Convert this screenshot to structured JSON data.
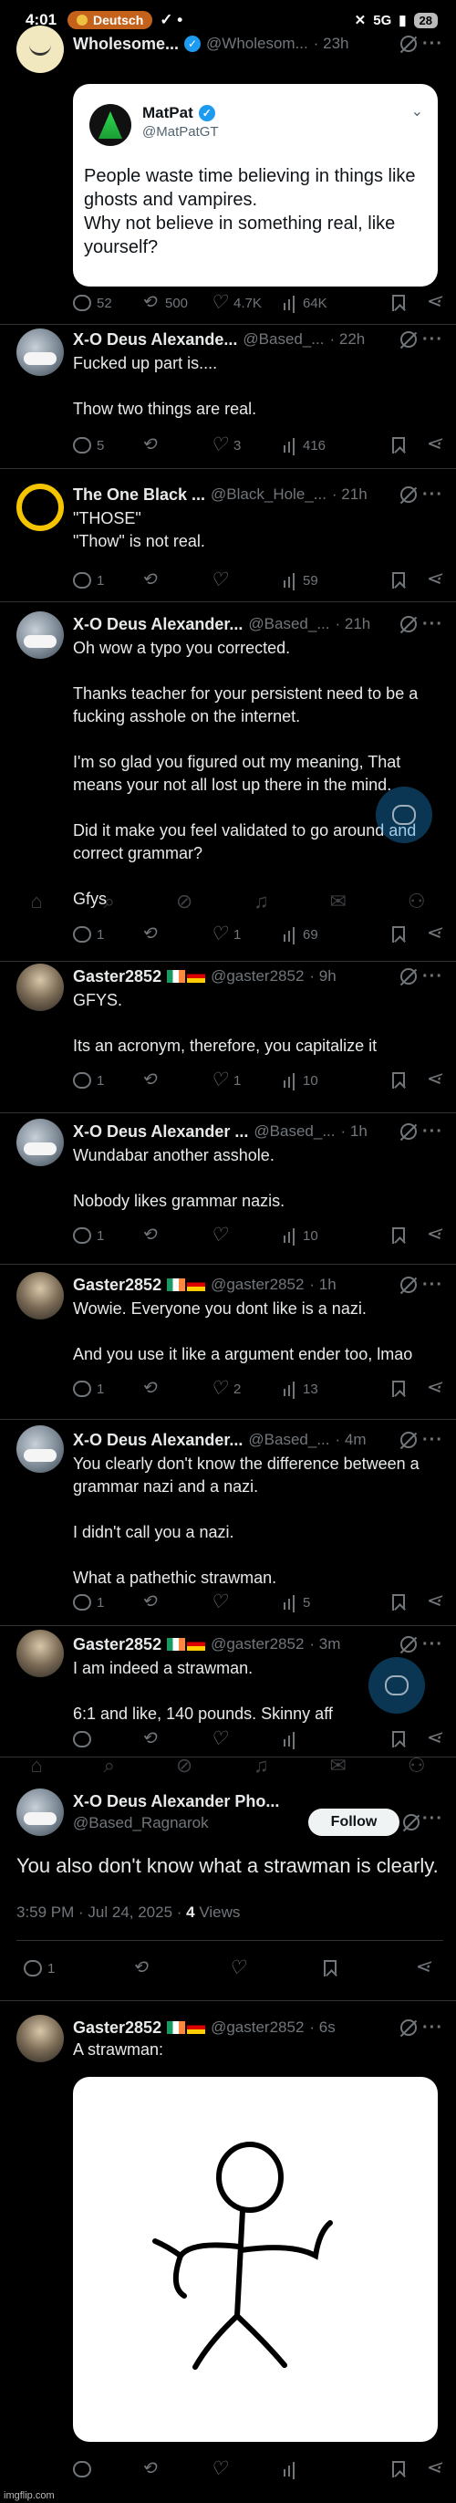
{
  "status": {
    "time": "4:01",
    "app_pill": "Deutsch",
    "network": "5G",
    "battery": "28"
  },
  "posts": [
    {
      "name": "Wholesome...",
      "handle": "@Wholesom...",
      "time": "· 23h",
      "quote": {
        "name": "MatPat",
        "handle": "@MatPatGT",
        "text": "People waste time believing in things like ghosts and vampires.\nWhy not believe in something real, like yourself?"
      },
      "replies": "52",
      "reposts": "500",
      "likes": "4.7K",
      "views": "64K"
    },
    {
      "name": "X-O Deus Alexande...",
      "handle": "@Based_...",
      "time": "· 22h",
      "text": "Fucked up part is....\n\nThow two things are real.",
      "replies": "5",
      "reposts": "",
      "likes": "3",
      "views": "416"
    },
    {
      "name": "The One Black ...",
      "handle": "@Black_Hole_...",
      "time": "· 21h",
      "text": "\"THOSE\"\n\"Thow\" is not real.",
      "replies": "1",
      "reposts": "",
      "likes": "",
      "views": "59"
    },
    {
      "name": "X-O Deus Alexander...",
      "handle": "@Based_...",
      "time": "· 21h",
      "text": "Oh wow a typo you corrected.\n\nThanks teacher for your persistent need to be a fucking asshole on the internet.\n\nI'm so glad you figured out my meaning, That means your not all lost up there in the mind.\n\nDid it make you feel validated to go around and correct grammar?\n\nGfys",
      "replies": "1",
      "reposts": "",
      "likes": "1",
      "views": "69"
    },
    {
      "name": "Gaster2852",
      "handle": "@gaster2852",
      "time": "· 9h",
      "text": "GFYS.\n\nIts an acronym, therefore, you capitalize it",
      "replies": "1",
      "reposts": "",
      "likes": "1",
      "views": "10"
    },
    {
      "name": "X-O Deus Alexander ...",
      "handle": "@Based_...",
      "time": "· 1h",
      "text": "Wundabar another asshole.\n\nNobody likes grammar nazis.",
      "replies": "1",
      "reposts": "",
      "likes": "",
      "views": "10"
    },
    {
      "name": "Gaster2852",
      "handle": "@gaster2852",
      "time": "· 1h",
      "text": "Wowie. Everyone you dont like is a nazi.\n\nAnd you use it like a argument ender too, lmao",
      "replies": "1",
      "reposts": "",
      "likes": "2",
      "views": "13"
    },
    {
      "name": "X-O Deus Alexander...",
      "handle": "@Based_...",
      "time": "· 4m",
      "text": "You clearly don't know the difference between a grammar nazi and a nazi.\n\nI didn't call you a nazi.\n\nWhat a pathethic strawman.",
      "replies": "1",
      "reposts": "",
      "likes": "",
      "views": "5"
    },
    {
      "name": "Gaster2852",
      "handle": "@gaster2852",
      "time": "· 3m",
      "text": "I am indeed a strawman.\n\n6:1 and like, 140 pounds. Skinny aff",
      "replies": "",
      "reposts": "",
      "likes": "",
      "views": ""
    }
  ],
  "focal": {
    "name": "X-O Deus Alexander Pho...",
    "handle": "@Based_Ragnarok",
    "follow": "Follow",
    "text": "You also don't know what a strawman is clearly.",
    "meta_time": "3:59 PM · Jul 24, 2025 · ",
    "meta_views_count": "4",
    "meta_views_label": " Views",
    "replies": "1"
  },
  "last": {
    "name": "Gaster2852",
    "handle": "@gaster2852",
    "time": "· 6s",
    "text": "A strawman:"
  },
  "watermark": "imgflip.com"
}
